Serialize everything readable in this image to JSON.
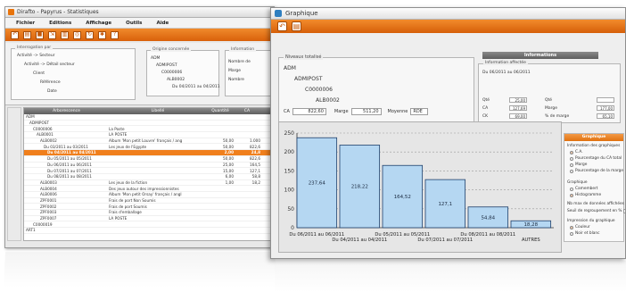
{
  "back_window": {
    "title": "Dirafto - Papyrus - Statistiques",
    "menu": [
      "Fichier",
      "Editions",
      "Affichage",
      "Outils",
      "Aide"
    ],
    "criteria": {
      "group_label": "Interrogation par",
      "lines": [
        "Activité -> Secteur",
        "Activité -> Détail secteur",
        "Client",
        "Référence",
        "Date"
      ]
    },
    "origin": {
      "group_label": "Origine concernée",
      "lines": [
        "ADM",
        "ADMIPOST",
        "C0000006",
        "ALB0002",
        "Du 04/2011 au 04/2011"
      ]
    },
    "info_label": "Information",
    "info_lines": [
      "Nombre de",
      "Marge",
      "Nombre"
    ],
    "grid": {
      "headers": [
        "Arborescence",
        "Libellé",
        "Quantité",
        "CA"
      ],
      "rows": [
        {
          "tree": "ADM",
          "label": "",
          "qte": "",
          "ca": ""
        },
        {
          "tree": "ADMIPOST",
          "label": "",
          "qte": "",
          "ca": ""
        },
        {
          "tree": "C0000006",
          "label": "La Poste",
          "qte": "",
          "ca": ""
        },
        {
          "tree": "ALB0001",
          "label": "LA POSTE",
          "qte": "",
          "ca": ""
        },
        {
          "tree": "ALB0002",
          "label": "Album 'Mon petit Louvre' français / ang",
          "qte": "50,00",
          "ca": "1.000"
        },
        {
          "tree": "Du 03/2011 au 03/2011",
          "label": "Les jeux de l'Egypte",
          "qte": "50,00",
          "ca": "822,6"
        },
        {
          "tree": "Du 04/2011 au 04/2011",
          "label": "",
          "qte": "2,00",
          "ca": "24,8"
        },
        {
          "tree": "Du 05/2011 au 05/2011",
          "label": "",
          "qte": "50,00",
          "ca": "822,6"
        },
        {
          "tree": "Du 06/2011 au 06/2011",
          "label": "",
          "qte": "25,00",
          "ca": "164,5"
        },
        {
          "tree": "Du 07/2011 au 07/2011",
          "label": "",
          "qte": "15,00",
          "ca": "127,1"
        },
        {
          "tree": "Du 08/2011 au 08/2011",
          "label": "",
          "qte": "6,00",
          "ca": "58,8"
        },
        {
          "tree": "ALB0003",
          "label": "Les jeux de la fiction",
          "qte": "1,00",
          "ca": "18,2"
        },
        {
          "tree": "ALB0004",
          "label": "Des jeux autour des impressionnistes",
          "qte": "",
          "ca": ""
        },
        {
          "tree": "ALB0006",
          "label": "Album 'Mon petit Orsay' français / angl",
          "qte": "",
          "ca": ""
        },
        {
          "tree": "ZPF0001",
          "label": "Frais de port Non Soumis",
          "qte": "",
          "ca": ""
        },
        {
          "tree": "ZPF0002",
          "label": "Frais de port Soumis",
          "qte": "",
          "ca": ""
        },
        {
          "tree": "ZPF0003",
          "label": "Frais d'emballage",
          "qte": "",
          "ca": ""
        },
        {
          "tree": "ZPF0007",
          "label": "LA POSTE",
          "qte": "",
          "ca": ""
        },
        {
          "tree": "C0000019",
          "label": "",
          "qte": "",
          "ca": ""
        },
        {
          "tree": "ART1",
          "label": "",
          "qte": "",
          "ca": ""
        }
      ],
      "selected_index": 6
    }
  },
  "front_window": {
    "title": "Graphique",
    "info_header": "Informations",
    "niveaux": {
      "group_label": "Niveaux totalisé",
      "lines": [
        "ADM",
        "ADMIPOST",
        "C0000006",
        "ALB0002"
      ]
    },
    "footer": {
      "ca_label": "CA",
      "ca_value": "822,60",
      "marge_label": "Marge",
      "marge_value": "511,20",
      "moyenne_label": "Moyenne",
      "moyenne_value": "RDE"
    },
    "info_effective": {
      "group_label": "Information affectée",
      "period": "Du 06/2011 au 06/2011",
      "rows": [
        {
          "label": "Qté",
          "value": "25,00",
          "label2": "Qté",
          "value2": ""
        },
        {
          "label": "CA",
          "value": "127,69",
          "label2": "Marge",
          "value2": "177,00"
        },
        {
          "label": "CK",
          "value": "69,00",
          "label2": "% de marge",
          "value2": "65,10"
        }
      ]
    },
    "legend": {
      "header": "Graphique",
      "group1": "Information des graphiques",
      "options1": [
        {
          "label": "C.A.",
          "on": true
        },
        {
          "label": "Pourcentage du CA total",
          "on": false
        },
        {
          "label": "Marge",
          "on": false
        },
        {
          "label": "Pourcentage de la marge",
          "on": false
        }
      ],
      "group2": "Graphique",
      "options2": [
        {
          "label": "Camembert",
          "on": false
        },
        {
          "label": "Histogramme",
          "on": true
        }
      ],
      "fields": [
        {
          "label": "Nb max de données affichées",
          "value": "10"
        },
        {
          "label": "Seuil de regroupement en %",
          "value": "10"
        }
      ],
      "group3": "Impression du graphique",
      "options3": [
        {
          "label": "Couleur",
          "on": true
        },
        {
          "label": "Noir et blanc",
          "on": false
        }
      ]
    }
  },
  "chart_data": {
    "type": "bar",
    "categories": [
      "Du 06/2011 au 06/2011",
      "Du 04/2011 au 04/2011",
      "Du 05/2011 au 05/2011",
      "Du 07/2011 au 07/2011",
      "Du 08/2011 au 08/2011",
      "AUTRES"
    ],
    "values": [
      237.64,
      218.22,
      164.52,
      127.1,
      54.84,
      18.28
    ],
    "value_labels": [
      "237,64",
      "218,22",
      "164,52",
      "127,1",
      "54,84",
      "18,28"
    ],
    "ylim": [
      0,
      250
    ],
    "yticks": [
      0,
      50,
      100,
      150,
      200,
      250
    ],
    "ytick_labels": [
      "0",
      "50",
      "100",
      "150",
      "200",
      "250"
    ],
    "grid": true,
    "bar_color": "#b5d7f2",
    "bar_stroke": "#1f3f6a"
  }
}
